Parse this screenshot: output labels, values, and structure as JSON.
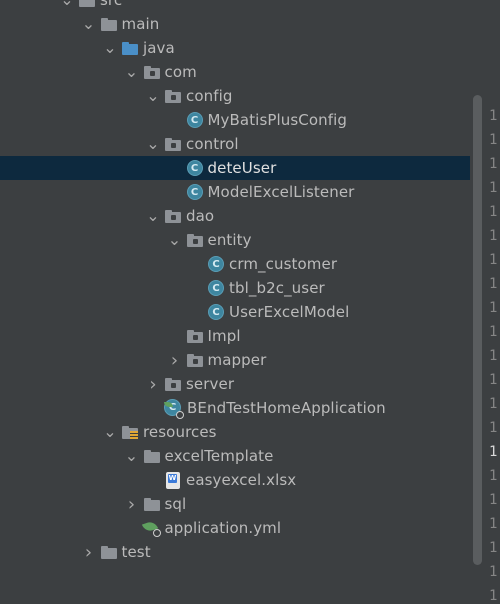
{
  "tree": [
    {
      "label": "src",
      "depth": 0,
      "arrow": "open",
      "icon": "folder"
    },
    {
      "label": "main",
      "depth": 1,
      "arrow": "open",
      "icon": "folder"
    },
    {
      "label": "java",
      "depth": 2,
      "arrow": "open",
      "icon": "source-folder"
    },
    {
      "label": "com",
      "depth": 3,
      "arrow": "open",
      "icon": "package"
    },
    {
      "label": "config",
      "depth": 4,
      "arrow": "open",
      "icon": "package"
    },
    {
      "label": "MyBatisPlusConfig",
      "depth": 5,
      "arrow": "none",
      "icon": "class"
    },
    {
      "label": "control",
      "depth": 4,
      "arrow": "open",
      "icon": "package"
    },
    {
      "label": "deteUser",
      "depth": 5,
      "arrow": "none",
      "icon": "class",
      "selected": true
    },
    {
      "label": "ModelExcelListener",
      "depth": 5,
      "arrow": "none",
      "icon": "class"
    },
    {
      "label": "dao",
      "depth": 4,
      "arrow": "open",
      "icon": "package"
    },
    {
      "label": "entity",
      "depth": 5,
      "arrow": "open",
      "icon": "package"
    },
    {
      "label": "crm_customer",
      "depth": 6,
      "arrow": "none",
      "icon": "class"
    },
    {
      "label": "tbl_b2c_user",
      "depth": 6,
      "arrow": "none",
      "icon": "class"
    },
    {
      "label": "UserExcelModel",
      "depth": 6,
      "arrow": "none",
      "icon": "class"
    },
    {
      "label": "Impl",
      "depth": 5,
      "arrow": "none",
      "icon": "package"
    },
    {
      "label": "mapper",
      "depth": 5,
      "arrow": "closed",
      "icon": "package"
    },
    {
      "label": "server",
      "depth": 4,
      "arrow": "closed",
      "icon": "package"
    },
    {
      "label": "BEndTestHomeApplication",
      "depth": 4,
      "arrow": "none",
      "icon": "app-class"
    },
    {
      "label": "resources",
      "depth": 2,
      "arrow": "open",
      "icon": "resources-folder"
    },
    {
      "label": "excelTemplate",
      "depth": 3,
      "arrow": "open",
      "icon": "folder"
    },
    {
      "label": "easyexcel.xlsx",
      "depth": 4,
      "arrow": "none",
      "icon": "xlsx-file"
    },
    {
      "label": "sql",
      "depth": 3,
      "arrow": "closed",
      "icon": "folder"
    },
    {
      "label": "application.yml",
      "depth": 3,
      "arrow": "none",
      "icon": "yml-file"
    },
    {
      "label": "test",
      "depth": 1,
      "arrow": "closed",
      "icon": "folder"
    }
  ],
  "gutter": [
    "1",
    "1",
    "1",
    "1",
    "1",
    "1",
    "1",
    "1",
    "1",
    "1",
    "1",
    "1",
    "1",
    "1",
    "1",
    "1",
    "1",
    "1",
    "1",
    "1",
    "1"
  ],
  "class_icon_letter": "C",
  "colors": {
    "selection": "#0d293e",
    "background": "#3c3f41",
    "class_icon": "#3e86a0",
    "source_folder": "#4a8fc7"
  }
}
